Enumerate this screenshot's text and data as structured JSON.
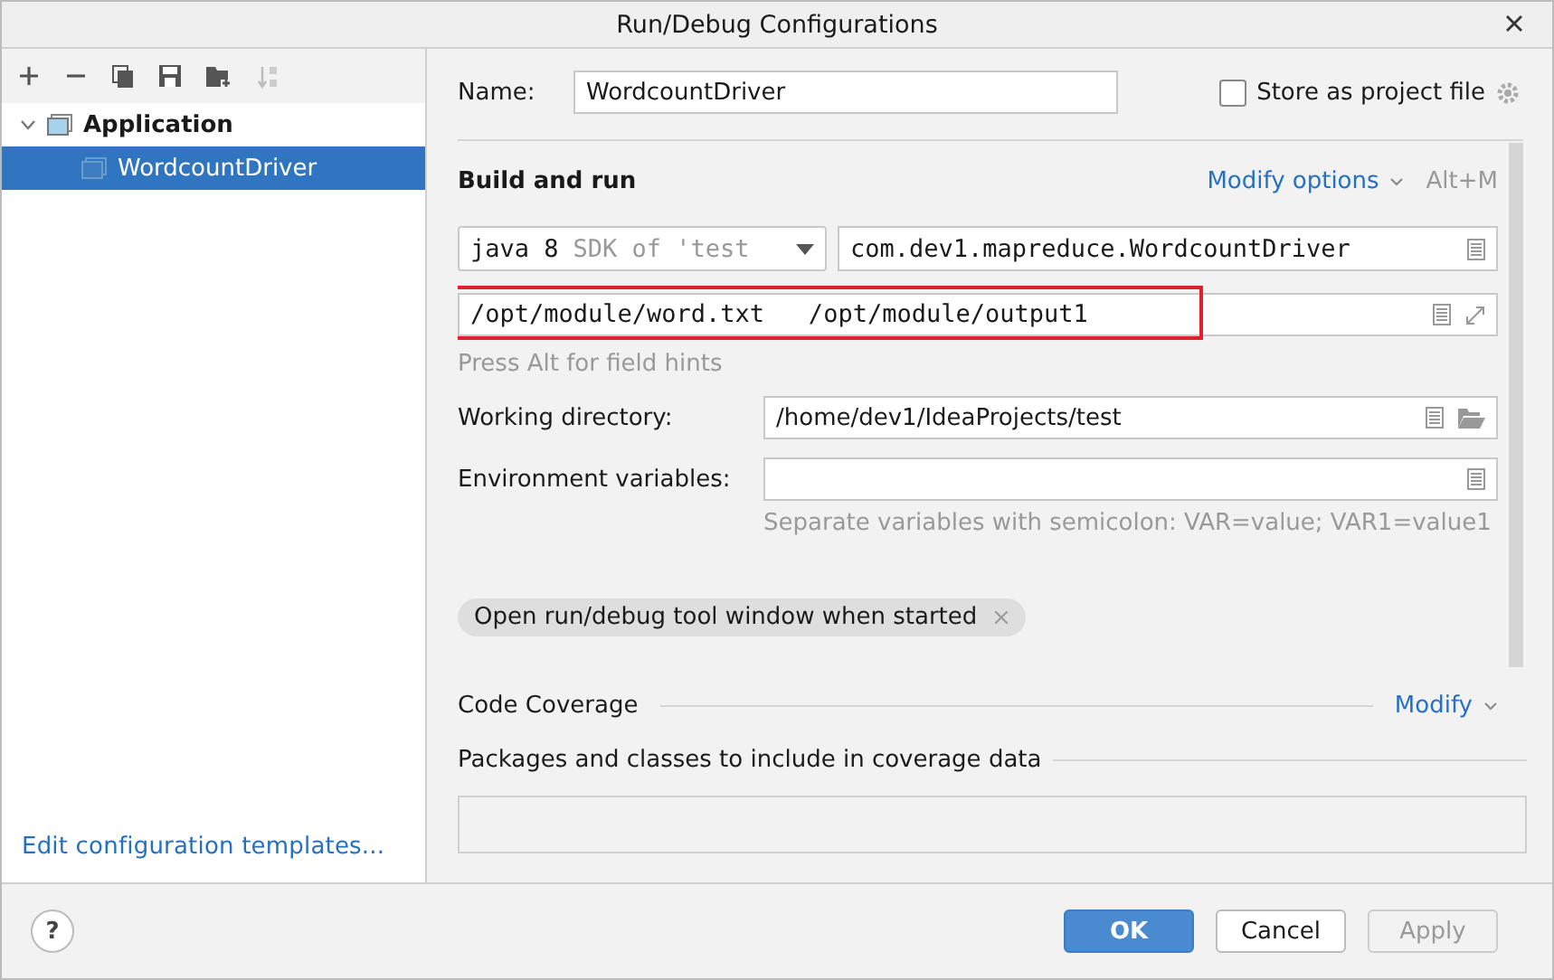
{
  "window": {
    "title": "Run/Debug Configurations"
  },
  "tree": [
    {
      "label": "Application",
      "expanded": true,
      "children": [
        {
          "label": "WordcountDriver",
          "selected": true
        }
      ]
    }
  ],
  "templates_link": "Edit configuration templates...",
  "name": {
    "label": "Name:",
    "value": "WordcountDriver"
  },
  "store": {
    "label": "Store as project file",
    "checked": false
  },
  "build": {
    "title": "Build and run",
    "modify": "Modify options",
    "shortcut": "Alt+M",
    "jre": {
      "value": "java 8",
      "hint": "SDK of 'test"
    },
    "main_class": "com.dev1.mapreduce.WordcountDriver",
    "args": {
      "value": "/opt/module/word.txt   /opt/module/output1",
      "highlighted": true
    },
    "hint": "Press Alt for field hints"
  },
  "working_dir": {
    "label": "Working directory:",
    "value": "/home/dev1/IdeaProjects/test"
  },
  "env": {
    "label": "Environment variables:",
    "hint": "Separate variables with semicolon: VAR=value; VAR1=value1"
  },
  "chip": "Open run/debug tool window when started",
  "coverage": {
    "title": "Code Coverage",
    "modify": "Modify",
    "packages": "Packages and classes to include in coverage data"
  },
  "help_button": "?",
  "buttons": [
    {
      "label": "OK",
      "kind": "primary",
      "disabled": false
    },
    {
      "label": "Cancel",
      "kind": "normal",
      "disabled": false
    },
    {
      "label": "Apply",
      "kind": "normal",
      "disabled": true
    }
  ]
}
